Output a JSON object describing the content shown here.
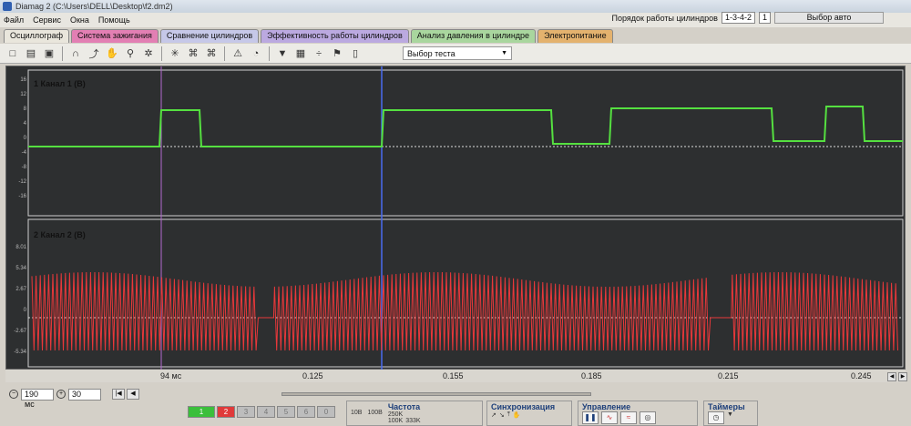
{
  "window": {
    "title": "Diamag 2 (C:\\Users\\DELL\\Desktop\\f2.dm2)"
  },
  "menu": [
    "Файл",
    "Сервис",
    "Окна",
    "Помощь"
  ],
  "order": {
    "label": "Порядок работы цилиндров",
    "value": "1-3-4-2",
    "cyl": "1",
    "auto": "Выбор авто"
  },
  "tabs": [
    {
      "label": "Осциллограф",
      "color": "#e9e6dc"
    },
    {
      "label": "Система зажигания",
      "color": "#e27fb3"
    },
    {
      "label": "Сравнение цилиндров",
      "color": "#c6c8e8"
    },
    {
      "label": "Эффективность работы цилиндров",
      "color": "#bba9e0"
    },
    {
      "label": "Анализ давления в цилиндре",
      "color": "#a9d69e"
    },
    {
      "label": "Электропитание",
      "color": "#e4b26e"
    }
  ],
  "toolbar": {
    "test_select": "Выбор теста"
  },
  "channels": {
    "ch1": {
      "label": "1 Канал 1 (В)",
      "color": "#55e040",
      "yticks": [
        "16",
        "12",
        "8",
        "4",
        "0",
        "-4",
        "-8",
        "-12",
        "-16"
      ]
    },
    "ch2": {
      "label": "2 Канал 2 (В)",
      "color": "#e8383a",
      "yticks": [
        "8.01",
        "5.34",
        "2.67",
        "0",
        "-2.67",
        "-5.34"
      ]
    }
  },
  "xaxis": [
    "94 мс",
    "0.125",
    "0.155",
    "0.185",
    "0.215",
    "0.245"
  ],
  "bottom": {
    "timebase": "190 мс",
    "zoom": "30",
    "channel_buttons": [
      "1",
      "2",
      "3",
      "4",
      "5",
      "6",
      "0"
    ],
    "frequency": {
      "title": "Частота",
      "values": [
        "250K",
        "100K",
        "333K"
      ],
      "volts": [
        "10В",
        "100В"
      ]
    },
    "sync": {
      "title": "Синхронизация"
    },
    "control": {
      "title": "Управление"
    },
    "timers": {
      "title": "Таймеры"
    }
  }
}
